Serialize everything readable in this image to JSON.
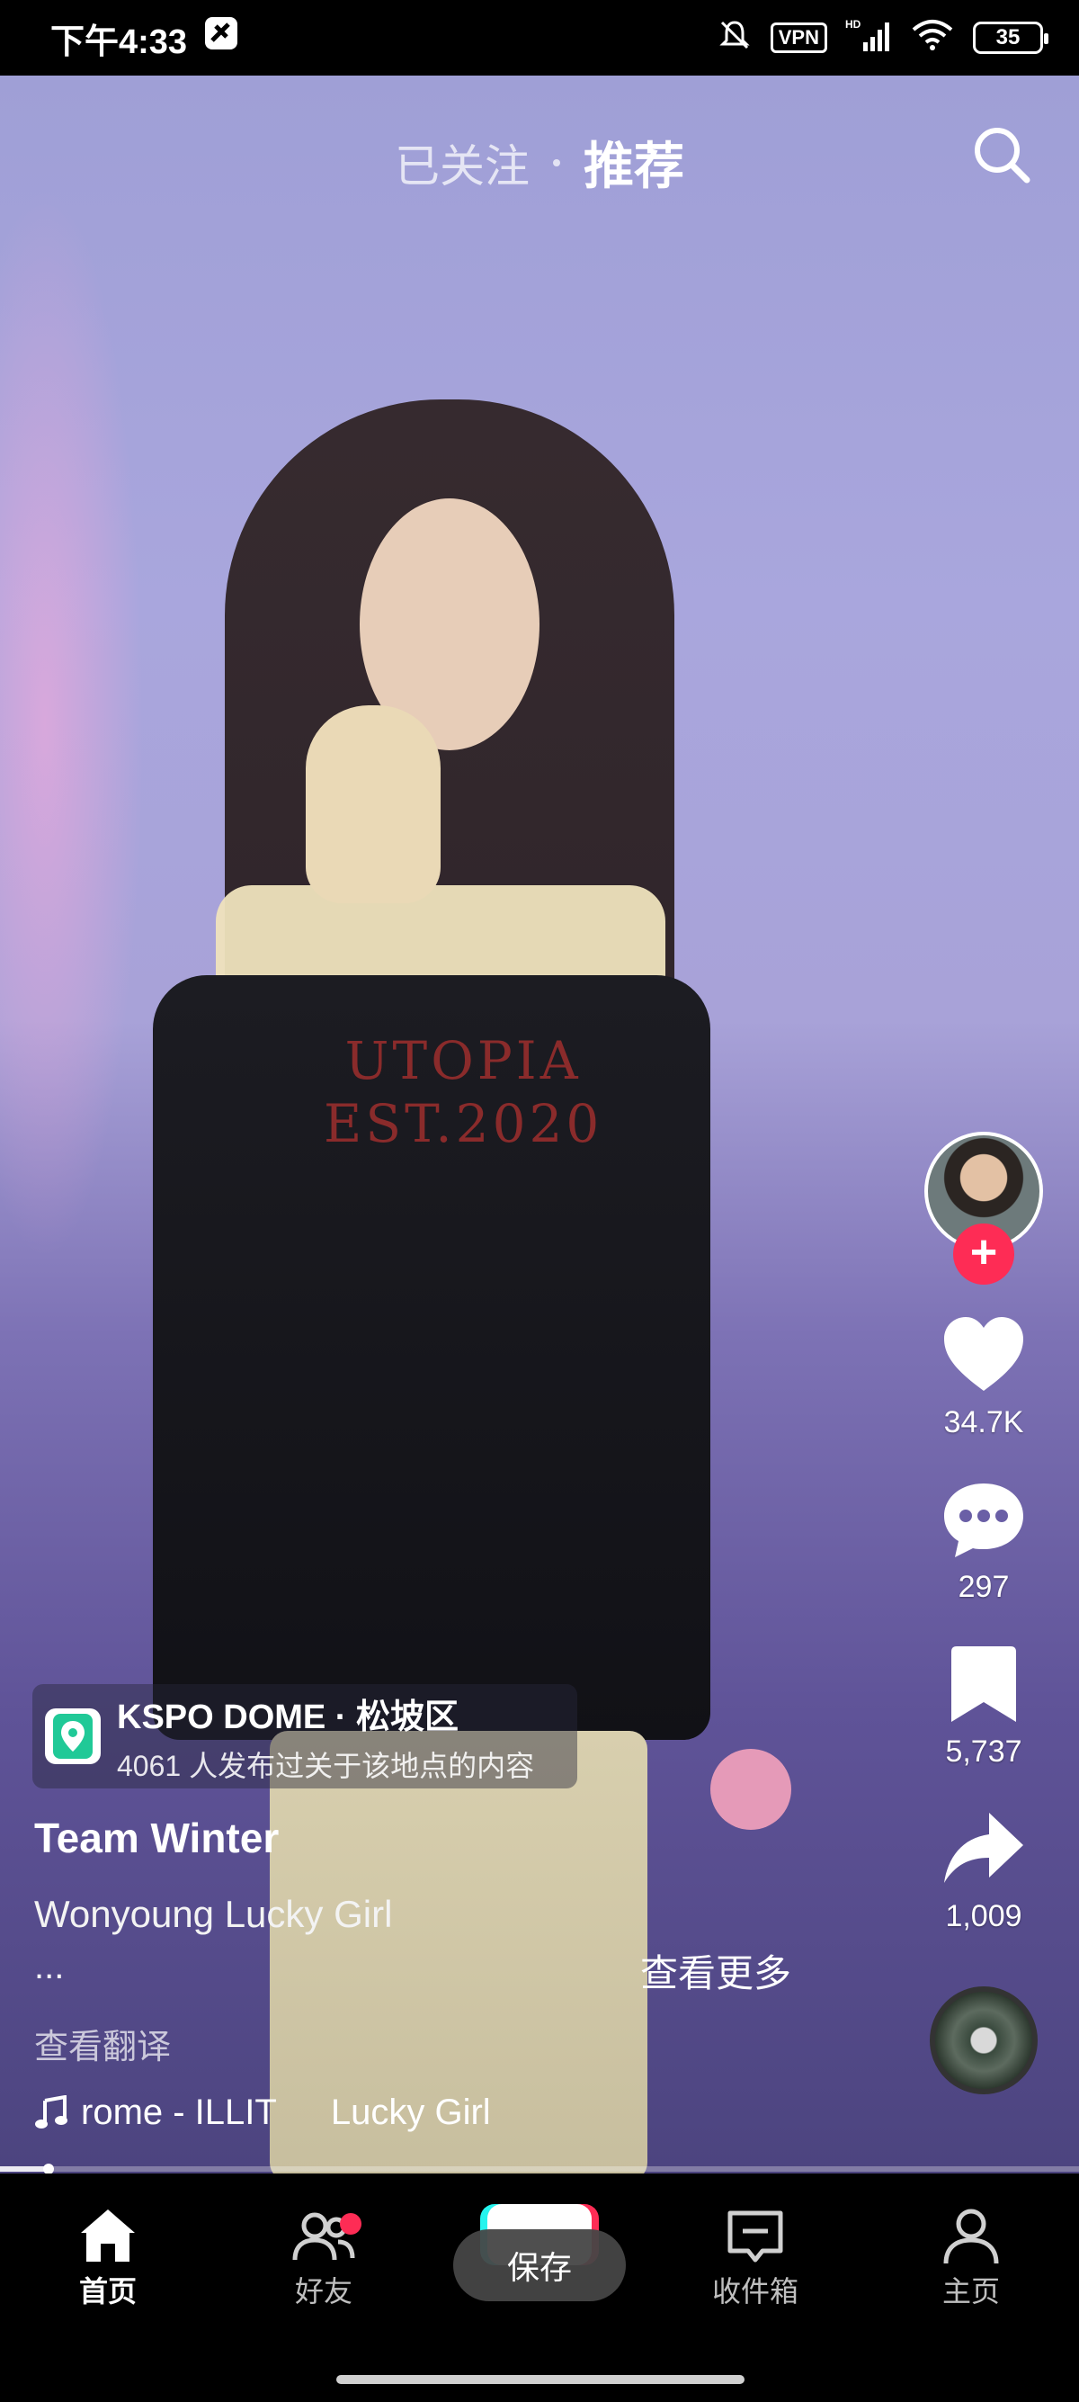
{
  "status_bar": {
    "time": "下午4:33",
    "vpn": "VPN",
    "network": "HD",
    "battery": "35"
  },
  "top_tabs": {
    "following": "已关注",
    "recommended": "推荐"
  },
  "video": {
    "dress_text_1": "UTOPIA",
    "dress_text_2": "EST.2020"
  },
  "actions": {
    "likes": "34.7K",
    "comments": "297",
    "favorites": "5,737",
    "shares": "1,009"
  },
  "location": {
    "title": "KSPO DOME · 松坡区",
    "subtitle": "4061 人发布过关于该地点的内容"
  },
  "post": {
    "username": "Team Winter",
    "caption": "Wonyoung Lucky Girl",
    "ellipsis": "...",
    "see_more": "查看更多",
    "translate": "查看翻译",
    "music_1": "rome - ILLIT",
    "music_2": "Lucky Girl"
  },
  "progress": {
    "fraction": 0.045
  },
  "bottom_nav": {
    "home": "首页",
    "friends": "好友",
    "inbox": "收件箱",
    "profile": "主页"
  },
  "toast": {
    "text": "保存"
  },
  "colors": {
    "accent": "#fe2c55",
    "cyan": "#25f4ee",
    "location_icon": "#20c997"
  }
}
